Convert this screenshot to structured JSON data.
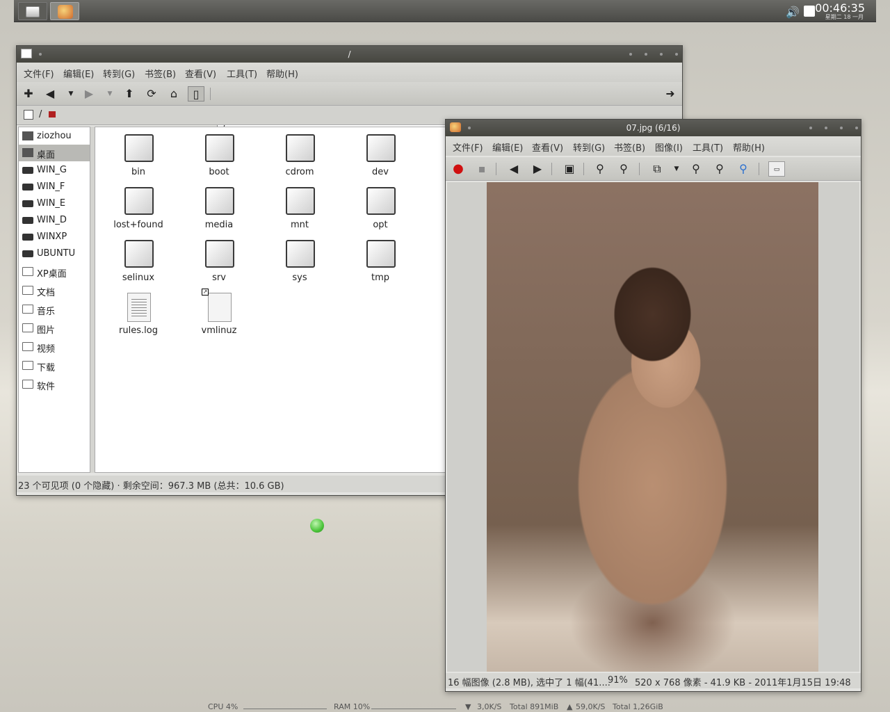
{
  "top_panel": {
    "clock_time": "00:46:35",
    "clock_date": "星期二 18 一月"
  },
  "file_manager": {
    "title": "/",
    "menu": [
      "文件(F)",
      "编辑(E)",
      "转到(G)",
      "书签(B)",
      "查看(V)",
      "工具(T)",
      "帮助(H)"
    ],
    "address": "/",
    "path_bar": "/",
    "sidebar": [
      {
        "label": "ziozhou",
        "icon": "home-icon",
        "selected": false
      },
      {
        "label": "桌面",
        "icon": "desktop-icon",
        "selected": true
      },
      {
        "label": "WIN_G",
        "icon": "drive-icon",
        "selected": false
      },
      {
        "label": "WIN_F",
        "icon": "drive-icon",
        "selected": false
      },
      {
        "label": "WIN_E",
        "icon": "drive-icon",
        "selected": false
      },
      {
        "label": "WIN_D",
        "icon": "drive-icon",
        "selected": false
      },
      {
        "label": "WINXP",
        "icon": "drive-icon",
        "selected": false
      },
      {
        "label": "UBUNTU",
        "icon": "drive-icon",
        "selected": false
      },
      {
        "label": "XP桌面",
        "icon": "folder-icon",
        "selected": false
      },
      {
        "label": "文档",
        "icon": "folder-icon",
        "selected": false
      },
      {
        "label": "音乐",
        "icon": "folder-icon",
        "selected": false
      },
      {
        "label": "图片",
        "icon": "folder-icon",
        "selected": false
      },
      {
        "label": "视频",
        "icon": "folder-icon",
        "selected": false
      },
      {
        "label": "下载",
        "icon": "folder-icon",
        "selected": false
      },
      {
        "label": "软件",
        "icon": "folder-icon",
        "selected": false
      }
    ],
    "files": [
      {
        "name": "bin",
        "type": "folder"
      },
      {
        "name": "boot",
        "type": "folder"
      },
      {
        "name": "cdrom",
        "type": "folder"
      },
      {
        "name": "dev",
        "type": "folder"
      },
      {
        "name": "lost+found",
        "type": "folder"
      },
      {
        "name": "media",
        "type": "folder"
      },
      {
        "name": "mnt",
        "type": "folder"
      },
      {
        "name": "opt",
        "type": "folder"
      },
      {
        "name": "selinux",
        "type": "folder"
      },
      {
        "name": "srv",
        "type": "folder"
      },
      {
        "name": "sys",
        "type": "folder"
      },
      {
        "name": "tmp",
        "type": "folder"
      },
      {
        "name": "rules.log",
        "type": "document"
      },
      {
        "name": "vmlinuz",
        "type": "symlink"
      }
    ],
    "status": "23 个可见项 (0 个隐藏) · 剩余空间：967.3 MB (总共：10.6 GB)"
  },
  "image_viewer": {
    "title": "07.jpg  (6/16)",
    "menu": [
      "文件(F)",
      "编辑(E)",
      "查看(V)",
      "转到(G)",
      "书签(B)",
      "图像(I)",
      "工具(T)",
      "帮助(H)"
    ],
    "status_left": "16 幅图像 (2.8 MB), 选中了 1 幅(41....",
    "status_zoom": "91%",
    "status_info": "520 x 768 像素 - 41.9 KB - 2011年1月15日 19:48"
  },
  "system_monitor": {
    "cpu": "CPU 4%",
    "ram": "RAM 10%",
    "down_rate": "3,0K/S",
    "down_total": "Total 891MiB",
    "up_rate": "59,0K/S",
    "up_total": "Total 1,26GiB"
  }
}
